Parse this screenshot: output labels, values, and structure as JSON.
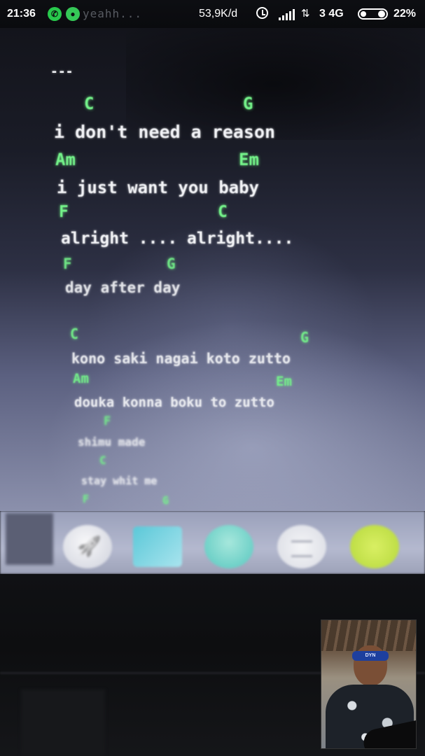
{
  "status_bar": {
    "time": "21:36",
    "notification_preview": "yeahh...",
    "net_speed": "53,9K/d",
    "data_indicator": "⇅",
    "network": "3 4G",
    "battery": "22%",
    "battery_level": 0.22,
    "icons": [
      "whatsapp-icon",
      "line-icon",
      "alarm-icon",
      "signal-icon",
      "battery-icon"
    ]
  },
  "lyrics": {
    "separator": "---",
    "lines": [
      {
        "chords": [
          "C",
          "G"
        ],
        "text": "i don't need a reason"
      },
      {
        "chords": [
          "Am",
          "Em"
        ],
        "text": "i just want you baby"
      },
      {
        "chords": [
          "F",
          "C"
        ],
        "text": "alright .... alright...."
      },
      {
        "chords": [
          "F",
          "G"
        ],
        "text": "day after day"
      },
      {
        "chords": [
          "C",
          "G"
        ],
        "text": "kono saki nagai koto zutto"
      },
      {
        "chords": [
          "Am",
          "Em"
        ],
        "text": "douka konna boku to zutto"
      },
      {
        "chords": [
          "F"
        ],
        "text": "shimu made"
      },
      {
        "chords": [
          "C"
        ],
        "text": "stay whit me"
      },
      {
        "chords": [
          "F",
          "G"
        ],
        "text": ""
      }
    ]
  },
  "dock": {
    "apps": [
      "rocket-icon",
      "files-icon",
      "photos-icon",
      "notes-icon",
      "chat-icon"
    ]
  },
  "self_view": {
    "headband_text": "DYN"
  },
  "colors": {
    "chord": "#74f38a",
    "lyric": "#f2f3f6",
    "statusbar_bg": "#0d0e12",
    "whatsapp": "#28c94c"
  }
}
